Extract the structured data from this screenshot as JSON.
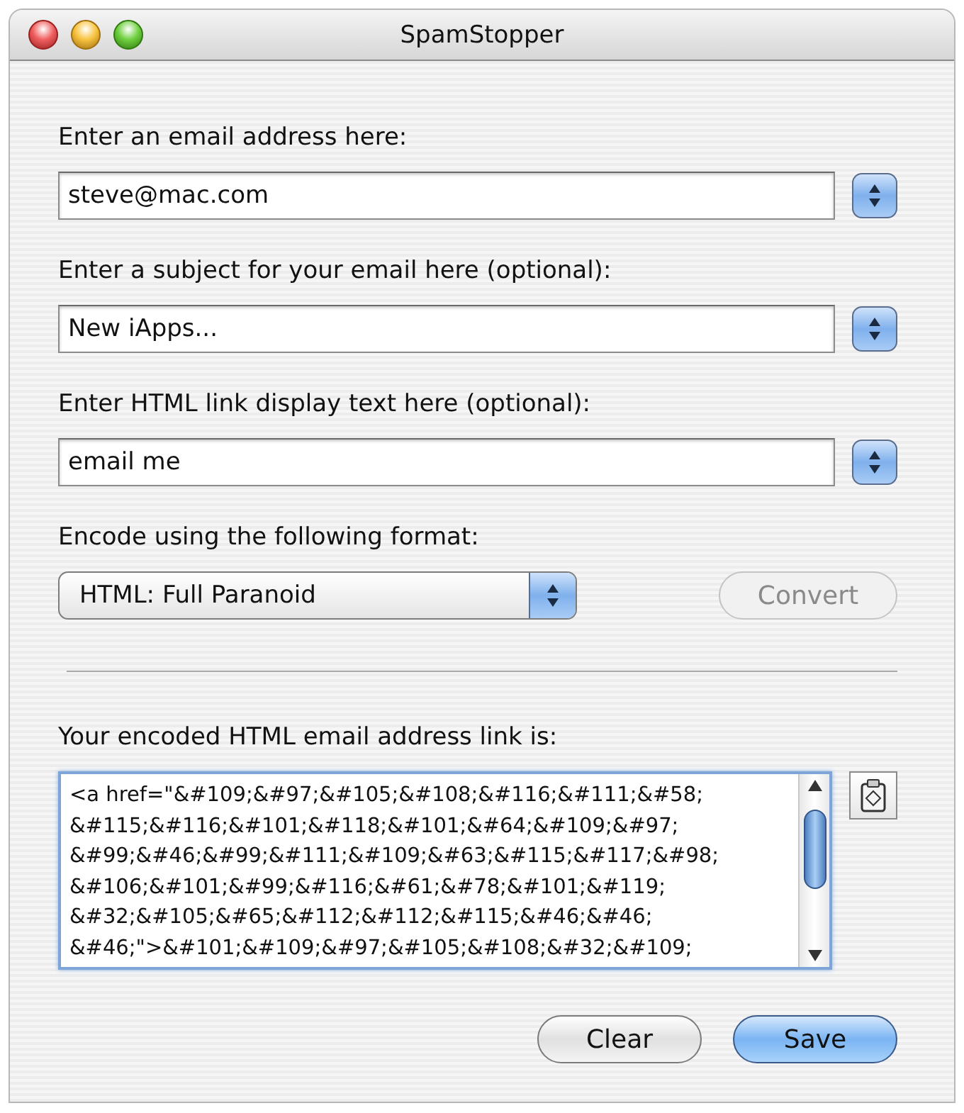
{
  "window": {
    "title": "SpamStopper"
  },
  "fields": [
    {
      "label": "Enter an email address here:",
      "value": "steve@mac.com"
    },
    {
      "label": "Enter a subject for your email here (optional):",
      "value": "New iApps..."
    },
    {
      "label": "Enter HTML link display text here (optional):",
      "value": "email me"
    }
  ],
  "format": {
    "label": "Encode using the following format:",
    "value": "HTML: Full Paranoid"
  },
  "convert_button": {
    "label": "Convert",
    "disabled": true
  },
  "output": {
    "label": "Your encoded HTML email address link is:",
    "lines": [
      "<a href=\"&#109;&#97;&#105;&#108;&#116;&#111;&#58;",
      "&#115;&#116;&#101;&#118;&#101;&#64;&#109;&#97;",
      "&#99;&#46;&#99;&#111;&#109;&#63;&#115;&#117;&#98;",
      "&#106;&#101;&#99;&#116;&#61;&#78;&#101;&#119;",
      "&#32;&#105;&#65;&#112;&#112;&#115;&#46;&#46;",
      "&#46;\">&#101;&#109;&#97;&#105;&#108;&#32;&#109;"
    ]
  },
  "buttons": [
    {
      "label": "Clear",
      "default": false
    },
    {
      "label": "Save",
      "default": true
    }
  ]
}
